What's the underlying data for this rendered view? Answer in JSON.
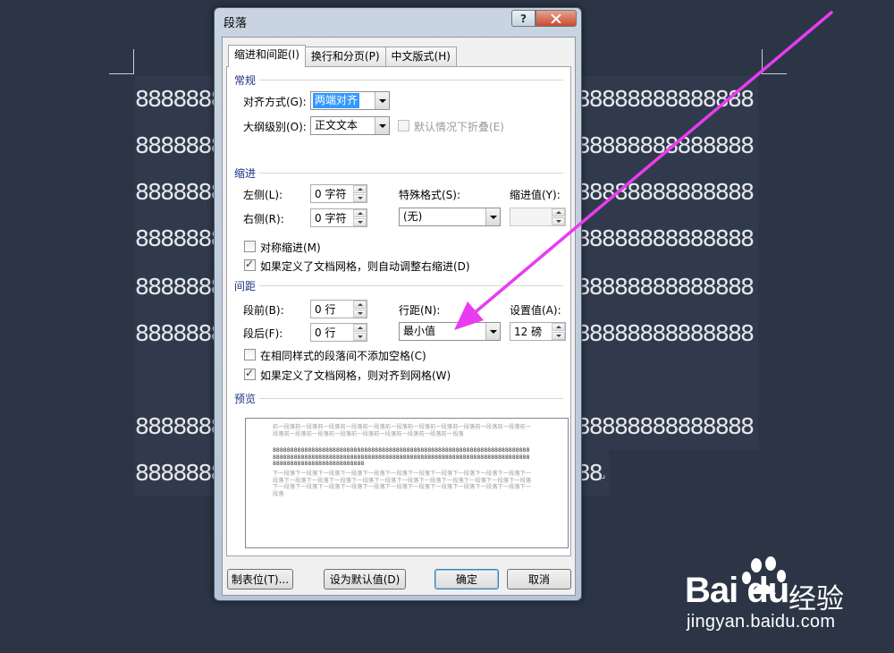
{
  "document": {
    "lines": [
      "8888888888888888888888888888888888888888888888888",
      "8888888888888888888888888888888888888888888888888",
      "8888888888888888888888888888888888888888888888888",
      "8888888888888888888888888888888888888888888888888",
      "8888888888888888888888888888888888888888888888888",
      "8888888888888888888888888888888888888888888888888",
      "8888888888888888888888888888888888888888888888888",
      "8888888888888888888888888888888888888"
    ],
    "paragraph_mark": "↵"
  },
  "dialog": {
    "title": "段落",
    "help_label": "?",
    "tabs": [
      {
        "label": "缩进和间距(I)",
        "active": true
      },
      {
        "label": "换行和分页(P)",
        "active": false
      },
      {
        "label": "中文版式(H)",
        "active": false
      }
    ],
    "general": {
      "title": "常规",
      "alignment_label": "对齐方式(G):",
      "alignment_value": "两端对齐",
      "outline_label": "大纲级别(O):",
      "outline_value": "正文文本",
      "collapse_label": "默认情况下折叠(E)"
    },
    "indent": {
      "title": "缩进",
      "left_label": "左侧(L):",
      "left_value": "0 字符",
      "right_label": "右侧(R):",
      "right_value": "0 字符",
      "special_label": "特殊格式(S):",
      "special_value": "(无)",
      "indent_by_label": "缩进值(Y):",
      "indent_by_value": "",
      "mirror_label": "对称缩进(M)",
      "mirror_checked": false,
      "auto_adjust_label": "如果定义了文档网格，则自动调整右缩进(D)",
      "auto_adjust_checked": true
    },
    "spacing": {
      "title": "间距",
      "before_label": "段前(B):",
      "before_value": "0 行",
      "after_label": "段后(F):",
      "after_value": "0 行",
      "line_spacing_label": "行距(N):",
      "line_spacing_value": "最小值",
      "at_label": "设置值(A):",
      "at_value": "12 磅",
      "no_space_label": "在相同样式的段落间不添加空格(C)",
      "no_space_checked": false,
      "snap_grid_label": "如果定义了文档网格，则对齐到网格(W)",
      "snap_grid_checked": true
    },
    "preview": {
      "title": "预览",
      "prev_text": "前一段落前一段落前一段落前一段落前一段落前一段落前一段落前一段落前一段落前一段落前一段落前一段落前一段落前一段落前一段落前一段落前一段落前一段落前一段落前一段落",
      "main_text": "8888888888888888888888888888888888888888888888888888888888888888888888888888888888888888888888888888888888888888888888888888888888888888888888888888888888888888888888888888",
      "next_text": "下一段落下一段落下一段落下一段落下一段落下一段落下一段落下一段落下一段落下一段落下一段落下一段落下一段落下一段落下一段落下一段落下一段落下一段落下一段落下一段落下一段落下一段落下一段落下一段落下一段落下一段落下一段落下一段落下一段落下一段落下一段落下一段落下一段落下一段落下一段落"
    },
    "buttons": {
      "tabs": "制表位(T)...",
      "set_default": "设为默认值(D)",
      "ok": "确定",
      "cancel": "取消"
    }
  },
  "watermark": {
    "logo": "Bai du",
    "brand_cn": "经验",
    "url": "jingyan.baidu.com"
  },
  "colors": {
    "background": "#2b3546",
    "arrow": "#e83cf0",
    "section_title": "#1e3287",
    "selection": "#3399ff"
  }
}
